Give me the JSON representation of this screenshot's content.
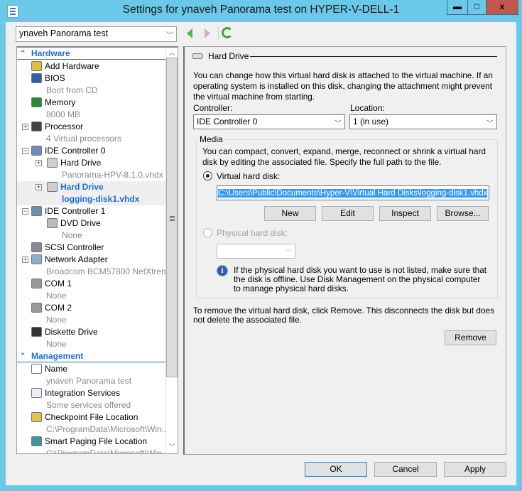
{
  "window": {
    "title": "Settings for ynaveh Panorama test on HYPER-V-DELL-1",
    "minimize": "▬",
    "maximize": "□",
    "close": "x",
    "close_color": "#c0574f",
    "frame_color": "#6ac8e8"
  },
  "vm_selector": {
    "value": "ynaveh Panorama test"
  },
  "tree": {
    "hardware_header": "Hardware",
    "management_header": "Management",
    "items": [
      {
        "label": "Add Hardware",
        "icon": "add-hardware-icon"
      },
      {
        "label": "BIOS",
        "sub": "Boot from CD",
        "icon": "bios-icon"
      },
      {
        "label": "Memory",
        "sub": "8000 MB",
        "icon": "memory-icon"
      },
      {
        "label": "Processor",
        "sub": "4 Virtual processors",
        "icon": "processor-icon",
        "expander": "+"
      },
      {
        "label": "IDE Controller 0",
        "icon": "ide-controller-icon",
        "expander": "−"
      },
      {
        "label": "Hard Drive",
        "sub": "Panorama-HPV-8.1.0.vhdx",
        "icon": "hard-drive-icon",
        "expander": "+",
        "level": 1
      },
      {
        "label": "Hard Drive",
        "sub": "logging-disk1.vhdx",
        "icon": "hard-drive-icon",
        "expander": "+",
        "level": 1,
        "selected": true
      },
      {
        "label": "IDE Controller 1",
        "icon": "ide-controller-icon",
        "expander": "−"
      },
      {
        "label": "DVD Drive",
        "sub": "None",
        "icon": "dvd-drive-icon",
        "level": 1
      },
      {
        "label": "SCSI Controller",
        "icon": "scsi-controller-icon"
      },
      {
        "label": "Network Adapter",
        "sub": "Broadcom BCM57800 NetXtrem...",
        "icon": "network-adapter-icon",
        "expander": "+"
      },
      {
        "label": "COM 1",
        "sub": "None",
        "icon": "com-port-icon"
      },
      {
        "label": "COM 2",
        "sub": "None",
        "icon": "com-port-icon"
      },
      {
        "label": "Diskette Drive",
        "sub": "None",
        "icon": "diskette-icon"
      }
    ],
    "management_items": [
      {
        "label": "Name",
        "sub": "ynaveh Panorama test",
        "icon": "name-icon"
      },
      {
        "label": "Integration Services",
        "sub": "Some services offered",
        "icon": "integration-services-icon"
      },
      {
        "label": "Checkpoint File Location",
        "sub": "C:\\ProgramData\\Microsoft\\Win...",
        "icon": "checkpoint-folder-icon"
      },
      {
        "label": "Smart Paging File Location",
        "sub": "C:\\ProgramData\\Microsoft\\Win...",
        "icon": "smart-paging-icon"
      }
    ]
  },
  "panel": {
    "title": "Hard Drive",
    "description": "You can change how this virtual hard disk is attached to the virtual machine. If an operating system is installed on this disk, changing the attachment might prevent the virtual machine from starting.",
    "controller_label": "Controller:",
    "controller_value": "IDE Controller 0",
    "location_label": "Location:",
    "location_value": "1 (in use)",
    "media": {
      "title": "Media",
      "description": "You can compact, convert, expand, merge, reconnect or shrink a virtual hard disk by editing the associated file. Specify the full path to the file.",
      "virtual_label": "Virtual hard disk:",
      "virtual_selected": true,
      "path": "C:\\Users\\Public\\Documents\\Hyper-V\\Virtual Hard Disks\\logging-disk1.vhdx",
      "buttons": {
        "new": "New",
        "edit": "Edit",
        "inspect": "Inspect",
        "browse": "Browse..."
      },
      "physical_label": "Physical hard disk:",
      "physical_value": "",
      "info": "If the physical hard disk you want to use is not listed, make sure that the disk is offline. Use Disk Management on the physical computer to manage physical hard disks."
    },
    "remove_text": "To remove the virtual hard disk, click Remove. This disconnects the disk but does not delete the associated file.",
    "remove_button": "Remove"
  },
  "footer": {
    "ok": "OK",
    "cancel": "Cancel",
    "apply": "Apply"
  }
}
